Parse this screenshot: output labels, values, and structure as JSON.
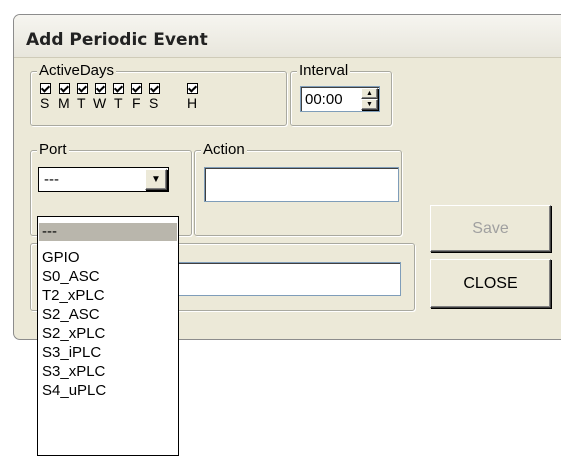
{
  "window": {
    "title": "Add Periodic Event"
  },
  "active_days": {
    "label": "ActiveDays",
    "days": [
      {
        "label": "S",
        "checked": true
      },
      {
        "label": "M",
        "checked": true
      },
      {
        "label": "T",
        "checked": true
      },
      {
        "label": "W",
        "checked": true
      },
      {
        "label": "T",
        "checked": true
      },
      {
        "label": "F",
        "checked": true
      },
      {
        "label": "S",
        "checked": true
      },
      {
        "label": "H",
        "checked": true
      }
    ]
  },
  "interval": {
    "label": "Interval",
    "value": "00:00"
  },
  "port": {
    "label": "Port",
    "selected": "---",
    "options": [
      "---",
      "GPIO",
      "S0_ASC",
      "T2_xPLC",
      "S2_ASC",
      "S2_xPLC",
      "S3_iPLC",
      "S3_xPLC",
      "S4_uPLC"
    ]
  },
  "action": {
    "label": "Action",
    "value": ""
  },
  "buttons": {
    "save": "Save",
    "close": "CLOSE"
  },
  "colors": {
    "dialog_bg": "#ece9d8",
    "selected_option_bg": "#b9b6ac",
    "disabled_text": "#a0a0a0"
  }
}
